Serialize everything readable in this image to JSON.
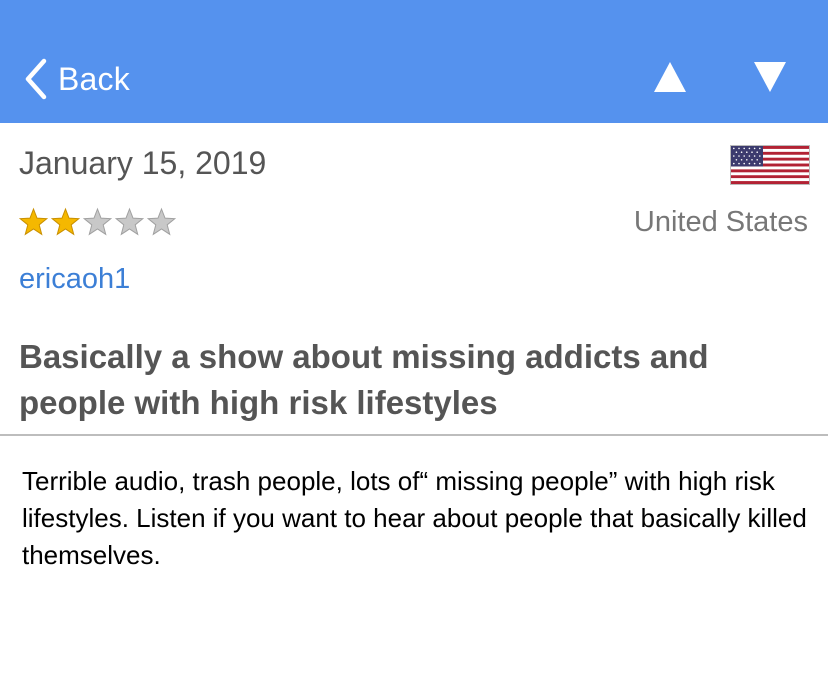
{
  "nav": {
    "back_label": "Back",
    "up_icon": "triangle-up-icon",
    "down_icon": "triangle-down-icon",
    "bar_color": "#5592ee"
  },
  "review": {
    "date": "January 15, 2019",
    "flag_icon": "us-flag-icon",
    "rating": 2,
    "max_rating": 5,
    "country": "United States",
    "author": "ericaoh1",
    "title": "Basically a show about missing addicts and people with high risk lifestyles",
    "body": "Terrible audio, trash people, lots of“ missing people” with high risk lifestyles. Listen if you want to hear about people that basically killed themselves."
  },
  "colors": {
    "author_link": "#3c7fd6",
    "star_filled": "#f5b800",
    "star_empty": "#c8c8c8"
  }
}
